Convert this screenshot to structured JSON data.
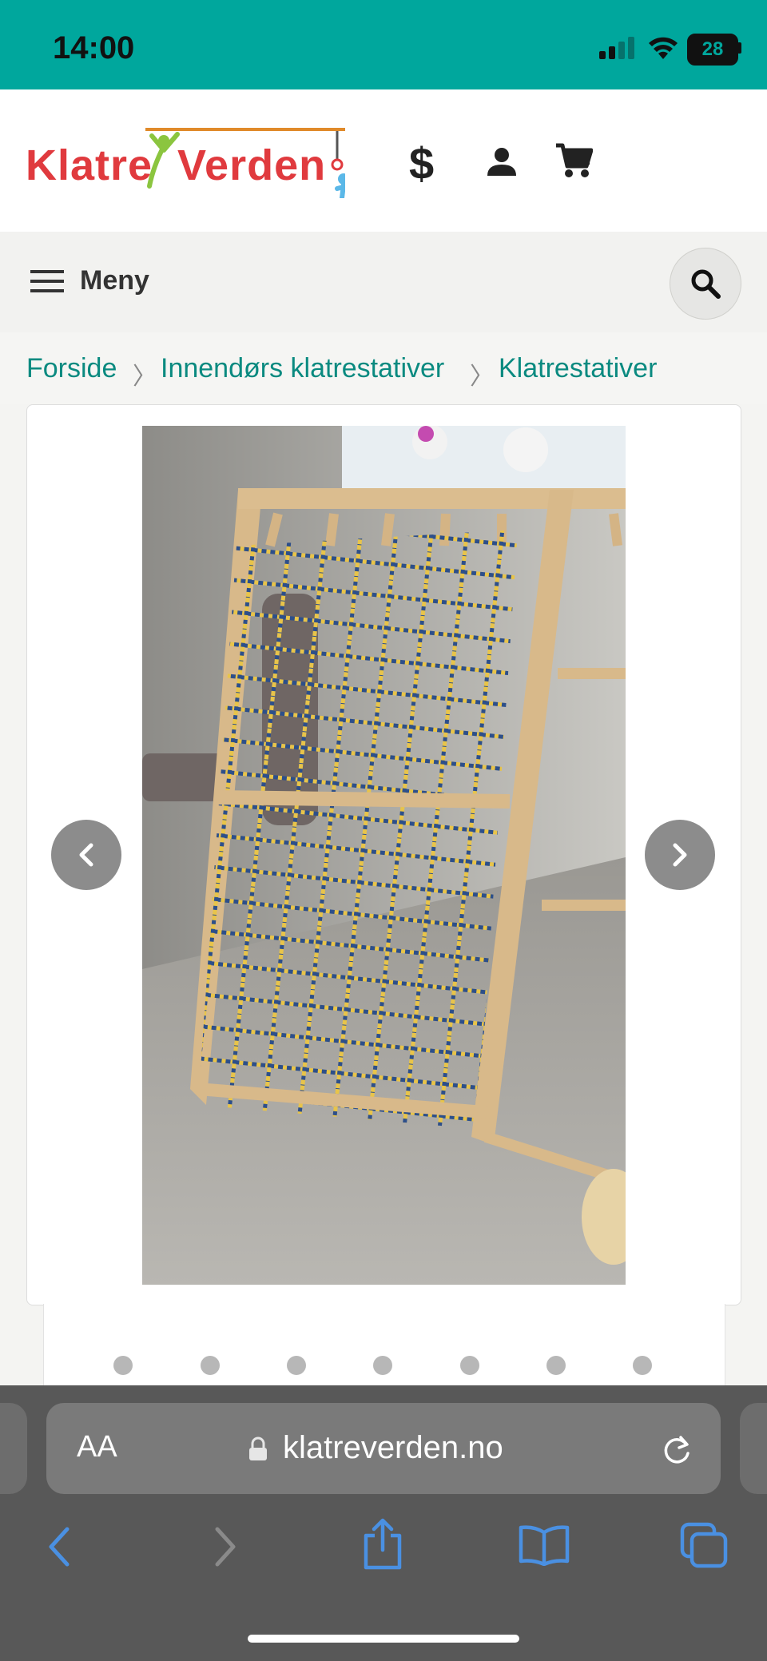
{
  "status_bar": {
    "time": "14:00",
    "battery": "28",
    "icons": [
      "signal-icon",
      "wifi-icon",
      "battery-icon"
    ]
  },
  "header": {
    "logo": {
      "part1": "Klatre",
      "part2": "Verden"
    },
    "icons": [
      "currency-icon",
      "account-icon",
      "cart-icon"
    ],
    "currency_symbol": "$"
  },
  "nav": {
    "menu_label": "Meny",
    "menu_icon": "hamburger-icon",
    "search_icon": "search-icon"
  },
  "breadcrumb": {
    "items": [
      "Forside",
      "Innendørs klatrestativer",
      "Klatrestativer"
    ],
    "separator": "〉"
  },
  "gallery": {
    "image_alt": "Wooden climbing frame with rope climbing net",
    "prev_icon": "chevron-left-icon",
    "next_icon": "chevron-right-icon",
    "dot_count": 7
  },
  "browser": {
    "text_size_label": "AA",
    "url": "klatreverden.no",
    "icons": [
      "lock-icon",
      "reload-icon",
      "back-icon",
      "forward-icon",
      "share-icon",
      "bookmarks-icon",
      "tabs-icon"
    ]
  },
  "colors": {
    "status_bar": "#00a79d",
    "link": "#0a8a80",
    "safari_bar": "#585858"
  }
}
